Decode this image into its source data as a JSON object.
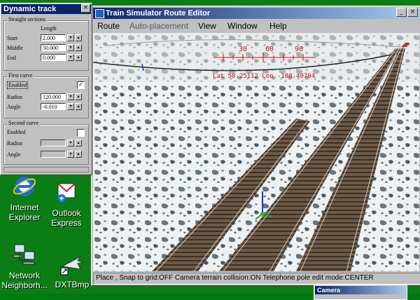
{
  "desktop": {
    "icons": [
      {
        "label_line1": "Internet",
        "label_line2": "Explorer",
        "icon": "internet-explorer-icon"
      },
      {
        "label_line1": "Outlook",
        "label_line2": "Express",
        "icon": "outlook-express-icon"
      },
      {
        "label_line1": "Network",
        "label_line2": "Neighborh...",
        "icon": "network-neighborhood-icon"
      },
      {
        "label_line1": "DXTBmp",
        "label_line2": "",
        "icon": "dxtbmp-shortcut-icon"
      }
    ],
    "background_color": "#0a7d14"
  },
  "editor": {
    "title": "Train Simulator Route Editor",
    "menu": [
      "Route",
      "Auto-placement",
      "View",
      "Window",
      "Help"
    ],
    "compass": {
      "ticks": [
        "30",
        "60",
        "90"
      ],
      "readout": "Lat 50.25112 Lon -108.40704"
    },
    "status": "Place , Snap to grid:OFF Camera terrain collision:ON Telephone pole edit mode:CENTER",
    "colors": {
      "title_start": "#0a246a",
      "title_end": "#a6caf0",
      "compass": "#d01010"
    }
  },
  "dynamic_track": {
    "title": "Dynamic track",
    "straight": {
      "title": "Straight sections",
      "column_header": "Length",
      "rows": [
        {
          "label": "Start",
          "value": "2.000"
        },
        {
          "label": "Middle",
          "value": "50.000"
        },
        {
          "label": "End",
          "value": "0.000"
        }
      ]
    },
    "first_curve": {
      "title": "First curve",
      "enabled_label": "Enabled",
      "enabled": true,
      "radius_label": "Radius",
      "radius": "120.000",
      "angle_label": "Angle",
      "angle": "-0.010"
    },
    "second_curve": {
      "title": "Second curve",
      "enabled_label": "Enabled",
      "enabled": false,
      "radius_label": "Radius",
      "angle_label": "Angle"
    }
  },
  "camera_window": {
    "title": "Camera"
  }
}
